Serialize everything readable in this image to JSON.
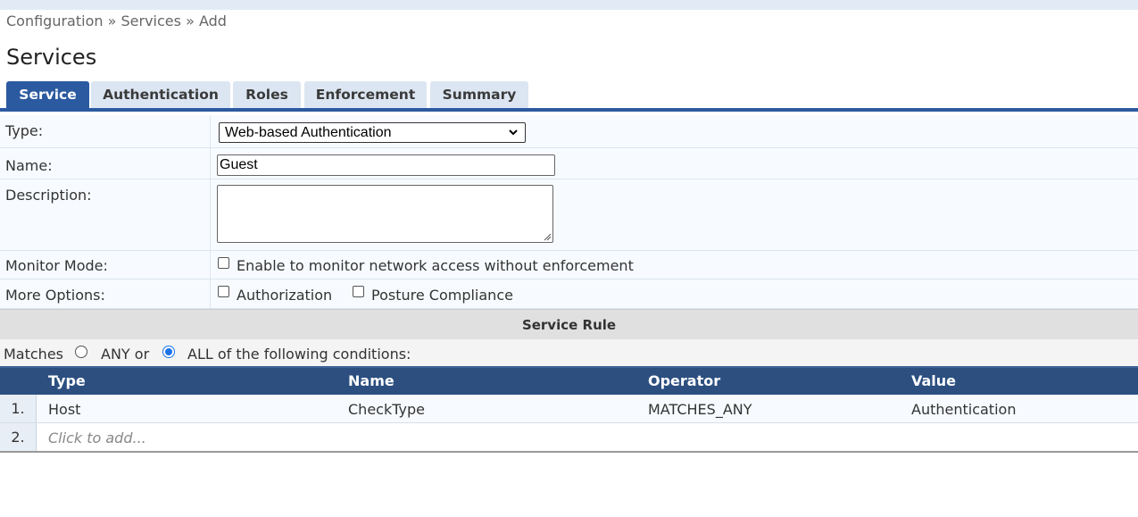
{
  "breadcrumb": {
    "part1": "Configuration",
    "sep1": "»",
    "part2": "Services",
    "sep2": "»",
    "part3": "Add"
  },
  "page_title": "Services",
  "tabs": [
    {
      "label": "Service",
      "active": true
    },
    {
      "label": "Authentication",
      "active": false
    },
    {
      "label": "Roles",
      "active": false
    },
    {
      "label": "Enforcement",
      "active": false
    },
    {
      "label": "Summary",
      "active": false
    }
  ],
  "form": {
    "type_label": "Type:",
    "type_value": "Web-based Authentication",
    "name_label": "Name:",
    "name_value": "Guest",
    "description_label": "Description:",
    "description_value": "",
    "monitor_label": "Monitor Mode:",
    "monitor_option": "Enable to monitor network access without enforcement",
    "monitor_checked": false,
    "more_label": "More Options:",
    "authorization_option": "Authorization",
    "authorization_checked": false,
    "posture_option": "Posture Compliance",
    "posture_checked": false
  },
  "service_rule": {
    "title": "Service Rule",
    "matches_label": "Matches",
    "any_label": "ANY or",
    "all_label": "ALL of the following conditions:",
    "selected": "ALL",
    "columns": [
      "Type",
      "Name",
      "Operator",
      "Value"
    ],
    "rows": [
      {
        "index": "1.",
        "type": "Host",
        "name": "CheckType",
        "operator": "MATCHES_ANY",
        "value": "Authentication"
      }
    ],
    "add_row": {
      "index": "2.",
      "placeholder": "Click to add..."
    }
  },
  "colors": {
    "accent": "#2c5aa0",
    "grid_header": "#2c4f80",
    "tab_inactive": "#dce6f2",
    "radio": "#1a73e8"
  }
}
